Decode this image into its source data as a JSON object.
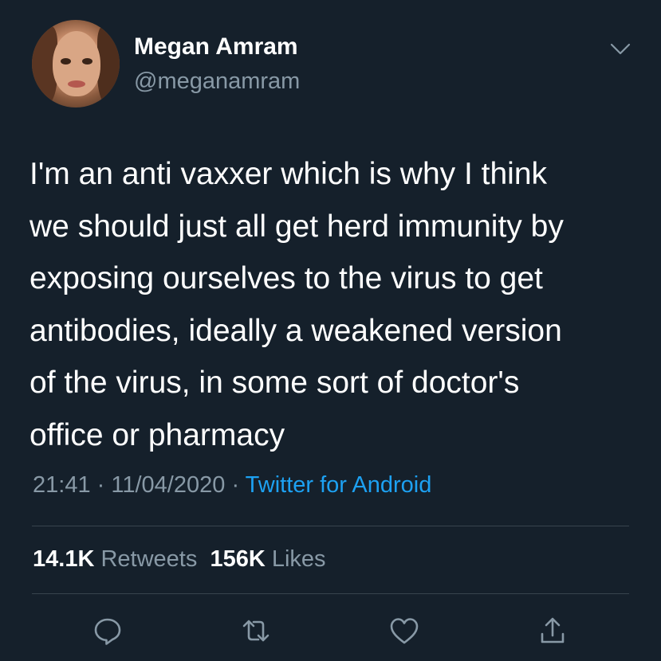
{
  "tweet": {
    "author": {
      "name": "Megan Amram",
      "handle": "@meganamram"
    },
    "text_lines": [
      "I'm an anti vaxxer which is why I think",
      "we should just all get herd immunity by",
      "exposing ourselves to the virus to get",
      "antibodies, ideally a weakened version",
      "of the virus, in some sort of doctor's",
      "office or pharmacy"
    ],
    "time": "21:41",
    "date": "11/04/2020",
    "separator": "·",
    "source": "Twitter for Android",
    "stats": {
      "retweets_count": "14.1K",
      "retweets_label": "Retweets",
      "likes_count": "156K",
      "likes_label": "Likes"
    }
  },
  "colors": {
    "background": "#15202b",
    "secondary_text": "#8899a6",
    "link": "#1da1f2",
    "divider": "#38444d"
  },
  "icons": [
    "chevron-down-icon",
    "reply-icon",
    "retweet-icon",
    "like-icon",
    "share-icon"
  ]
}
